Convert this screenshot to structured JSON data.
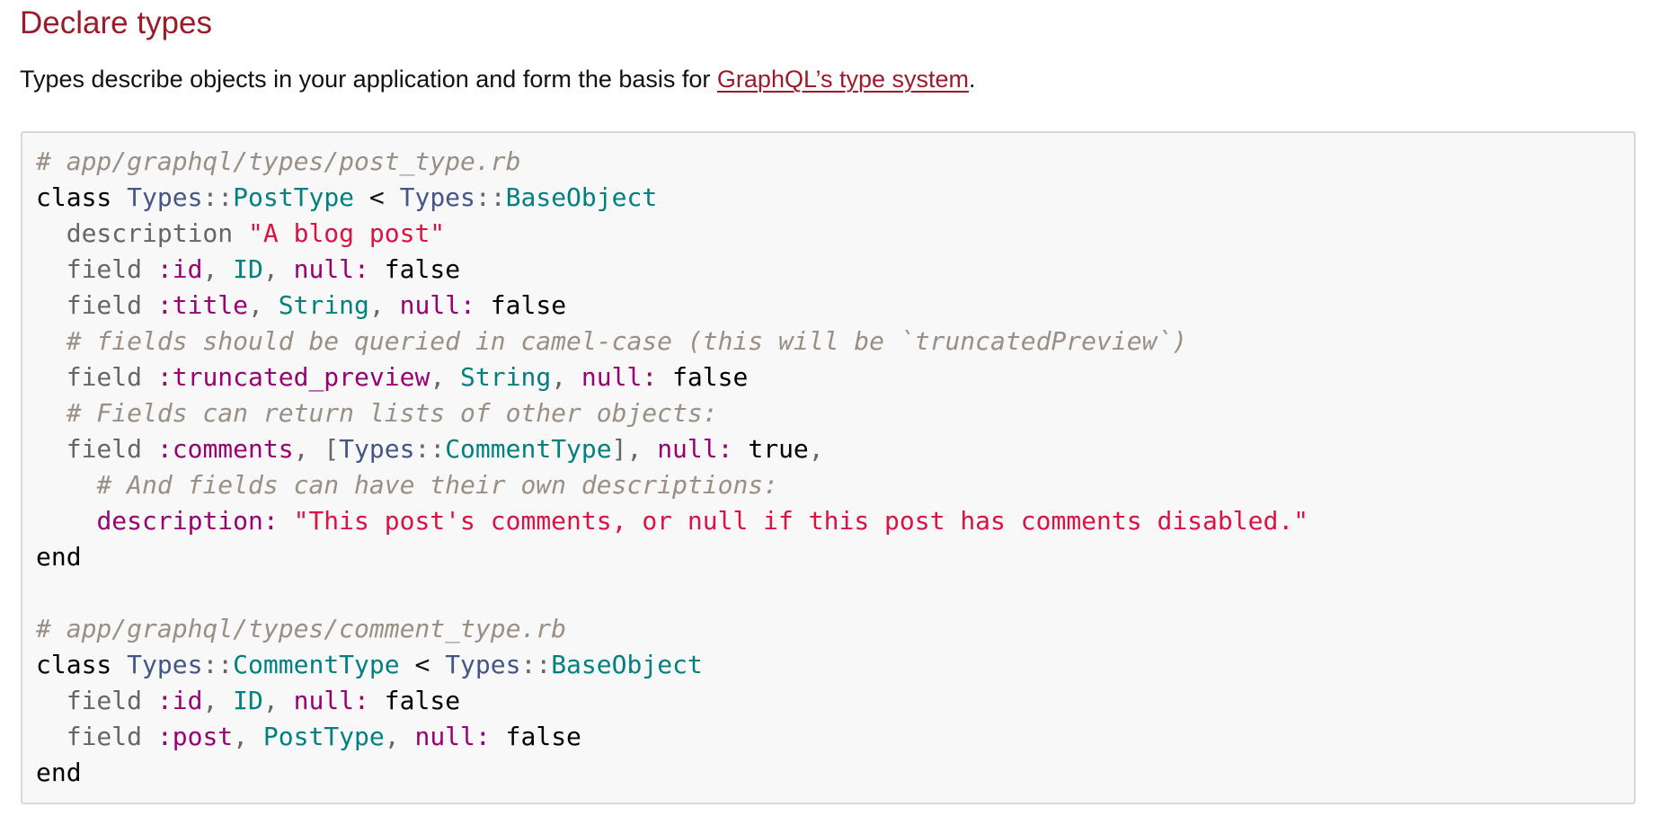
{
  "heading": "Declare types",
  "intro": {
    "text_before": "Types describe objects in your application and form the basis for ",
    "link_label": "GraphQL’s type system",
    "text_after": "."
  },
  "code": {
    "language": "ruby",
    "lines": [
      "# app/graphql/types/post_type.rb",
      "class Types::PostType < Types::BaseObject",
      "  description \"A blog post\"",
      "  field :id, ID, null: false",
      "  field :title, String, null: false",
      "  # fields should be queried in camel-case (this will be `truncatedPreview`)",
      "  field :truncated_preview, String, null: false",
      "  # Fields can return lists of other objects:",
      "  field :comments, [Types::CommentType], null: true,",
      "    # And fields can have their own descriptions:",
      "    description: \"This post's comments, or null if this post has comments disabled.\"",
      "end",
      "",
      "# app/graphql/types/comment_type.rb",
      "class Types::CommentType < Types::BaseObject",
      "  field :id, ID, null: false",
      "  field :post, PostType, null: false",
      "end"
    ]
  },
  "colors": {
    "heading": "#9e1a2b",
    "link": "#9e1a2b",
    "code_background": "#f8f8f8",
    "code_border": "#d8d8d8",
    "comment": "#998f84",
    "namespace": "#445588",
    "constant": "#008080",
    "symbol": "#990073",
    "string": "#dd1144",
    "identifier": "#666666"
  }
}
